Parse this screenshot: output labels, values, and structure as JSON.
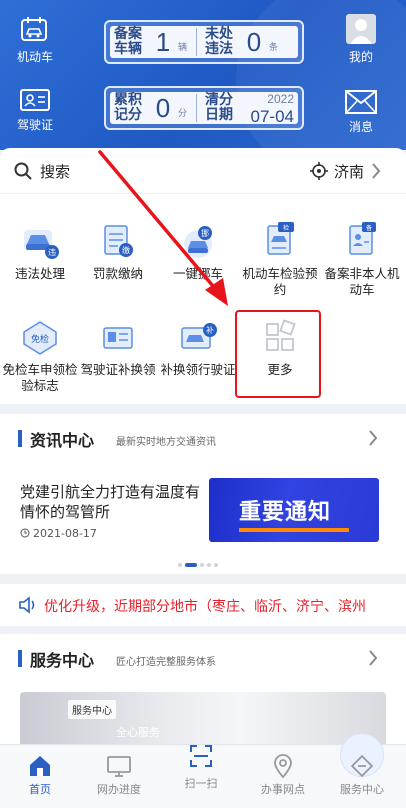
{
  "header": {
    "left_buttons": [
      {
        "label": "机动车",
        "icon": "car-calendar-icon"
      },
      {
        "label": "驾驶证",
        "icon": "id-card-icon"
      }
    ],
    "right_buttons": [
      {
        "label": "我的",
        "icon": "avatar-icon"
      },
      {
        "label": "消息",
        "icon": "envelope-icon"
      }
    ],
    "vehicle_card": {
      "label_a": "备案车辆",
      "value_a": "1",
      "unit_a": "辆",
      "label_b": "未处违法",
      "value_b": "0",
      "unit_b": "条"
    },
    "score_card": {
      "label_a": "累积记分",
      "value_a": "0",
      "unit_a": "分",
      "label_b": "清分日期",
      "year": "2022",
      "date": "07-04"
    }
  },
  "search": {
    "placeholder": "搜索",
    "city": "济南"
  },
  "services_grid": [
    {
      "label": "违法处理",
      "icon": "violation-car-icon"
    },
    {
      "label": "罚款缴纳",
      "icon": "fine-payment-icon"
    },
    {
      "label": "一键挪车",
      "icon": "move-car-icon"
    },
    {
      "label": "机动车检验预约",
      "icon": "inspection-booking-icon"
    },
    {
      "label": "备案非本人机动车",
      "icon": "vehicle-record-icon"
    },
    {
      "label": "免检车申领检验标志",
      "icon": "exempt-sticker-icon"
    },
    {
      "label": "驾驶证补换领",
      "icon": "license-replace-icon"
    },
    {
      "label": "补换领行驶证",
      "icon": "driving-permit-icon"
    },
    {
      "label": "更多",
      "icon": "more-grid-icon"
    }
  ],
  "news": {
    "title": "资讯中心",
    "subtitle": "最新实时地方交通资讯",
    "item_title": "党建引航全力打造有温度有情怀的驾管所",
    "item_date": "2021-08-17",
    "image_text": "重要通知"
  },
  "notice": {
    "text": "优化升级，近期部分地市（枣庄、临沂、济宁、滨州"
  },
  "service_center": {
    "title": "服务中心",
    "subtitle": "匠心打造完整服务体系",
    "tag": "服务中心",
    "caption": "全心服务"
  },
  "tabbar": [
    {
      "label": "首页",
      "icon": "home-icon",
      "active": true
    },
    {
      "label": "网办进度",
      "icon": "monitor-icon",
      "active": false
    },
    {
      "label": "扫一扫",
      "icon": "scan-icon",
      "active": false
    },
    {
      "label": "办事网点",
      "icon": "location-pin-icon",
      "active": false
    },
    {
      "label": "服务中心",
      "icon": "service-icon",
      "active": false
    }
  ],
  "colors": {
    "header_blue": "#2a62cc",
    "accent_blue": "#2a5fc4",
    "notice_red": "#e8202a",
    "annotation_red": "#e8141b"
  }
}
